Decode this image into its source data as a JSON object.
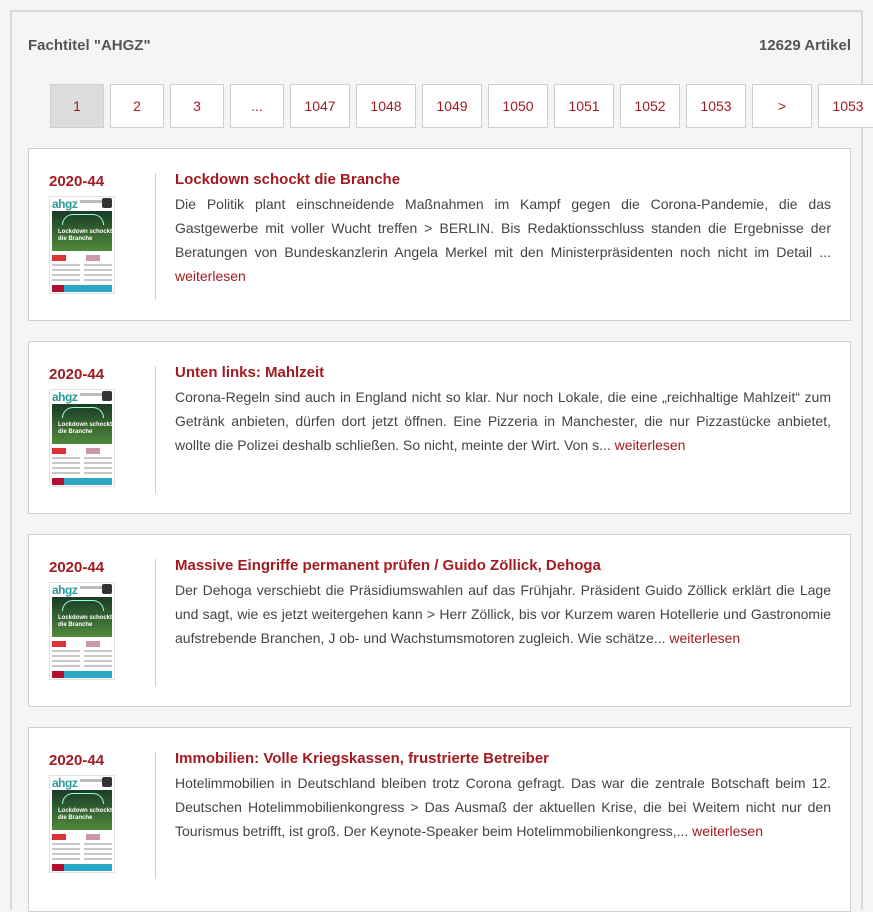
{
  "header": {
    "title": "Fachtitel \"AHGZ\"",
    "count": "12629 Artikel"
  },
  "pagination": [
    {
      "label": "1",
      "active": true
    },
    {
      "label": "2"
    },
    {
      "label": "3"
    },
    {
      "label": "..."
    },
    {
      "label": "1047"
    },
    {
      "label": "1048"
    },
    {
      "label": "1049"
    },
    {
      "label": "1050"
    },
    {
      "label": "1051"
    },
    {
      "label": "1052"
    },
    {
      "label": "1053"
    },
    {
      "label": ">"
    },
    {
      "label": "1053"
    }
  ],
  "thumbnail": {
    "logo": "ahgz",
    "headline": "Lockdown schockt die Branche"
  },
  "articles": [
    {
      "issue": "2020-44",
      "title": "Lockdown schockt die Branche",
      "text": "Die Politik plant einschneidende Maßnahmen im Kampf gegen die Corona-Pandemie, die das Gastgewerbe mit voller Wucht treffen > BERLIN. Bis Redaktionsschluss standen die Ergebnisse der Beratungen von Bundeskanzlerin Angela Merkel mit den Ministerpräsidenten noch nicht im Detail ... ",
      "more": "weiterlesen"
    },
    {
      "issue": "2020-44",
      "title": "Unten links: Mahlzeit",
      "text": "Corona-Regeln sind auch in England nicht so klar. Nur noch Lokale, die eine „reichhaltige Mahlzeit“ zum Getränk anbieten, dürfen dort jetzt öffnen. Eine Pizzeria in Manchester, die nur Pizzastücke anbietet, wollte die Polizei deshalb schließen. So nicht, meinte der Wirt. Von s... ",
      "more": "weiterlesen"
    },
    {
      "issue": "2020-44",
      "title": "Massive Eingriffe permanent prüfen / Guido Zöllick, Dehoga",
      "text": "Der Dehoga verschiebt die Präsidiumswahlen auf das Frühjahr. Präsident Guido Zöllick erklärt die Lage und sagt, wie es jetzt weitergehen kann > Herr Zöllick, bis vor Kurzem waren Hotellerie und Gastronomie aufstrebende Branchen, J ob- und Wachstumsmotoren zugleich. Wie schätze... ",
      "more": "weiterlesen"
    },
    {
      "issue": "2020-44",
      "title": "Immobilien: Volle Kriegskassen, frustrierte Betreiber",
      "text": "Hotelimmobilien in Deutschland bleiben trotz Corona gefragt. Das war die zentrale Botschaft beim 12. Deutschen Hotelimmobilienkongress > Das Ausmaß der aktuellen Krise, die bei Weitem nicht nur den Tourismus betrifft, ist groß. Der Keynote-Speaker beim Hotelimmobilienkongress,... ",
      "more": "weiterlesen"
    }
  ]
}
